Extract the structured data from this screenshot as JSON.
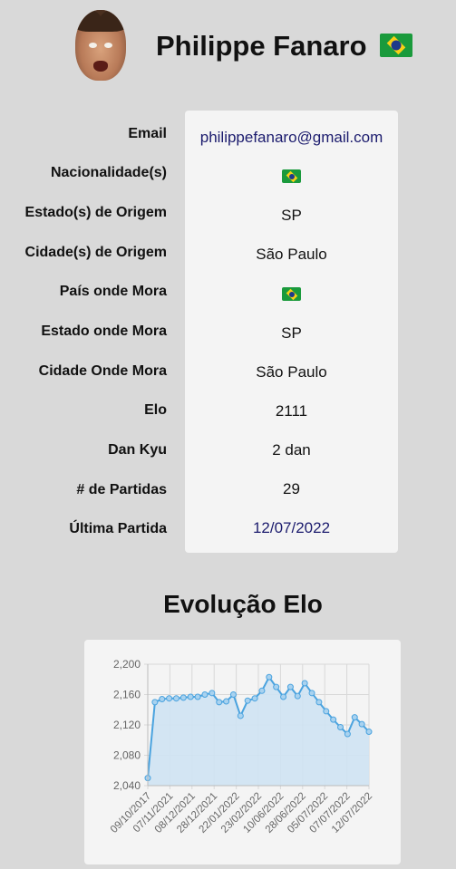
{
  "profile": {
    "name": "Philippe Fanaro",
    "flag_icon": "brazil-flag-icon",
    "avatar_icon": "profile-photo"
  },
  "details": [
    {
      "key": "email",
      "label": "Email",
      "value": "philippefanaro@gmail.com",
      "type": "link"
    },
    {
      "key": "nationality",
      "label": "Nacionalidade(s)",
      "value": "",
      "type": "flag"
    },
    {
      "key": "state_origin",
      "label": "Estado(s) de Origem",
      "value": "SP",
      "type": "text"
    },
    {
      "key": "city_origin",
      "label": "Cidade(s) de Origem",
      "value": "São Paulo",
      "type": "text"
    },
    {
      "key": "country_lives",
      "label": "País onde Mora",
      "value": "",
      "type": "flag"
    },
    {
      "key": "state_lives",
      "label": "Estado onde Mora",
      "value": "SP",
      "type": "text"
    },
    {
      "key": "city_lives",
      "label": "Cidade Onde Mora",
      "value": "São Paulo",
      "type": "text"
    },
    {
      "key": "elo",
      "label": "Elo",
      "value": "2111",
      "type": "text"
    },
    {
      "key": "dan_kyu",
      "label": "Dan Kyu",
      "value": "2 dan",
      "type": "text"
    },
    {
      "key": "games",
      "label": "# de Partidas",
      "value": "29",
      "type": "text"
    },
    {
      "key": "last_game",
      "label": "Última Partida",
      "value": "12/07/2022",
      "type": "link"
    }
  ],
  "chart_title": "Evolução Elo",
  "colors": {
    "background": "#d9d9d9",
    "card": "#f4f4f4",
    "link": "#1c1c6e",
    "line": "#4aa3df",
    "fill": "#cfe3f3",
    "flag_green": "#1a9a3c",
    "flag_yellow": "#f7d116",
    "flag_blue": "#1d3a8a"
  },
  "chart_data": {
    "type": "area",
    "title": "",
    "xlabel": "",
    "ylabel": "",
    "ylim": [
      2040,
      2200
    ],
    "yticks": [
      "2,040",
      "2,080",
      "2,120",
      "2,160",
      "2,200"
    ],
    "xticks": [
      "09/10/2017",
      "07/11/2021",
      "08/12/2021",
      "28/12/2021",
      "22/01/2022",
      "23/02/2022",
      "10/06/2022",
      "28/06/2022",
      "05/07/2022",
      "07/07/2022",
      "12/07/2022"
    ],
    "grid": true,
    "legend": "none",
    "series": [
      {
        "values": [
          2050,
          2150,
          2154,
          2155,
          2155,
          2156,
          2157,
          2157,
          2160,
          2162,
          2150,
          2151,
          2160,
          2132,
          2152,
          2155,
          2165,
          2183,
          2170,
          2157,
          2170,
          2158,
          2175,
          2162,
          2150,
          2138,
          2127,
          2117,
          2108,
          2130,
          2121,
          2111
        ]
      }
    ]
  }
}
